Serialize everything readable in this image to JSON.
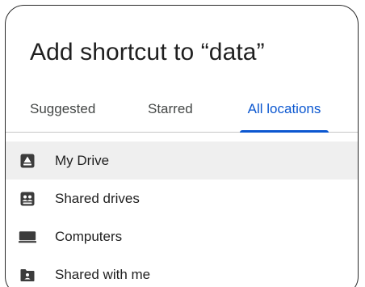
{
  "dialog": {
    "title": "Add shortcut to “data”"
  },
  "tabs": [
    {
      "label": "Suggested",
      "active": false
    },
    {
      "label": "Starred",
      "active": false
    },
    {
      "label": "All locations",
      "active": true
    }
  ],
  "locations": [
    {
      "label": "My Drive",
      "icon": "my-drive-icon",
      "selected": true
    },
    {
      "label": "Shared drives",
      "icon": "shared-drives-icon",
      "selected": false
    },
    {
      "label": "Computers",
      "icon": "computer-icon",
      "selected": false
    },
    {
      "label": "Shared with me",
      "icon": "shared-with-me-icon",
      "selected": false
    }
  ],
  "colors": {
    "accent": "#0b57d0",
    "text": "#1f1f1f",
    "tab_inactive": "#444746",
    "selected_row": "#efefef",
    "icon": "#3c3c3c"
  }
}
